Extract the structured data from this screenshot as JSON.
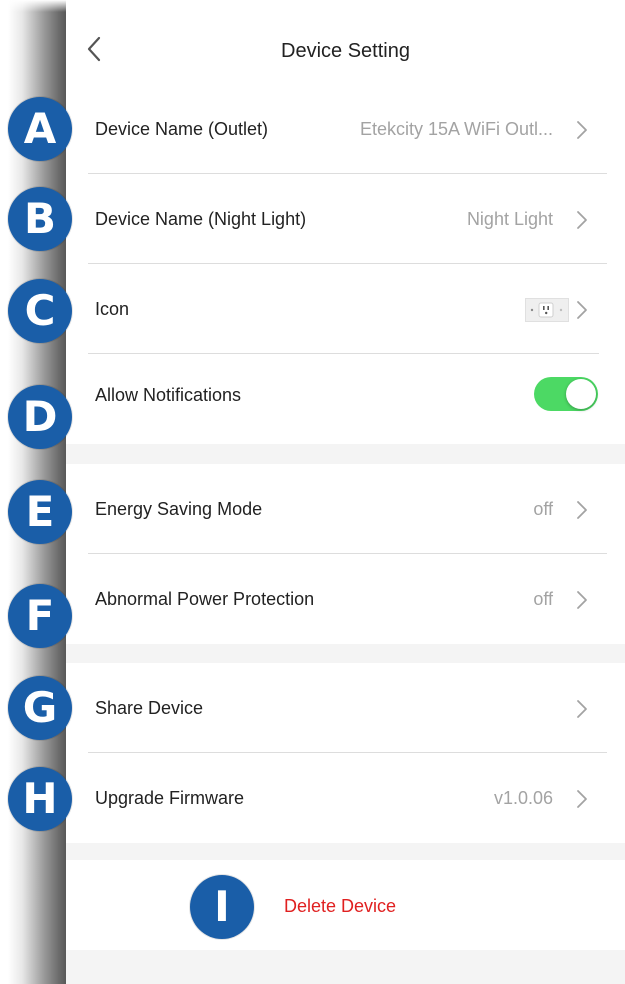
{
  "header": {
    "title": "Device Setting",
    "back_icon": "chevron-left-icon"
  },
  "settings": {
    "device_name_outlet": {
      "label": "Device Name (Outlet)",
      "value": "Etekcity 15A WiFi Outl..."
    },
    "device_name_night_light": {
      "label": "Device Name (Night Light)",
      "value": "Night Light"
    },
    "icon": {
      "label": "Icon"
    },
    "allow_notifications": {
      "label": "Allow Notifications",
      "enabled": true
    },
    "energy_saving_mode": {
      "label": "Energy Saving Mode",
      "value": "off"
    },
    "abnormal_power_protection": {
      "label": "Abnormal Power Protection",
      "value": "off"
    },
    "share_device": {
      "label": "Share Device"
    },
    "upgrade_firmware": {
      "label": "Upgrade Firmware",
      "value": "v1.0.06"
    },
    "delete_device": {
      "label": "Delete Device"
    }
  },
  "badges": [
    "A",
    "B",
    "C",
    "D",
    "E",
    "F",
    "G",
    "H",
    "I"
  ],
  "colors": {
    "toggle_on": "#4cd964",
    "delete_text": "#e02020",
    "badge_fill": "#1a5ea8",
    "secondary_text": "#a3a3a3"
  }
}
